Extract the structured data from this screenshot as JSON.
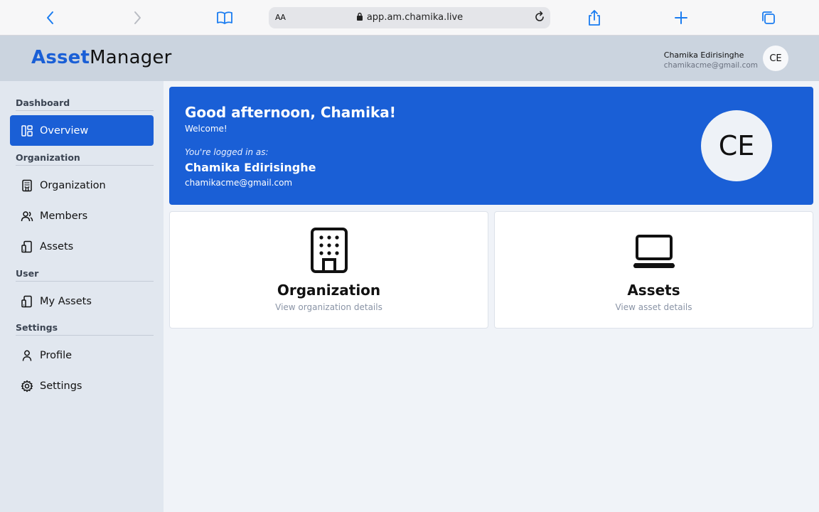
{
  "browser": {
    "aa_label": "AA",
    "url": "app.am.chamika.live",
    "icons": [
      "back-icon",
      "forward-icon",
      "bookmarks-icon",
      "lock-icon",
      "reload-icon",
      "share-icon",
      "new-tab-icon",
      "tabs-icon"
    ]
  },
  "header": {
    "logo_part1": "Asset",
    "logo_part2": "Manager",
    "user_name": "Chamika Edirisinghe",
    "user_email": "chamikacme@gmail.com",
    "avatar_initials": "CE"
  },
  "sidebar": {
    "sections": [
      {
        "title": "Dashboard",
        "items": [
          {
            "label": "Overview",
            "icon": "layout-icon",
            "active": true
          }
        ]
      },
      {
        "title": "Organization",
        "items": [
          {
            "label": "Organization",
            "icon": "building-icon"
          },
          {
            "label": "Members",
            "icon": "users-icon"
          },
          {
            "label": "Assets",
            "icon": "devices-icon"
          }
        ]
      },
      {
        "title": "User",
        "items": [
          {
            "label": "My Assets",
            "icon": "devices-icon"
          }
        ]
      },
      {
        "title": "Settings",
        "items": [
          {
            "label": "Profile",
            "icon": "user-icon"
          },
          {
            "label": "Settings",
            "icon": "gear-icon"
          }
        ]
      }
    ]
  },
  "welcome": {
    "greeting": "Good afternoon, Chamika!",
    "welcome_text": "Welcome!",
    "logged_in_as": "You're logged in as:",
    "name": "Chamika Edirisinghe",
    "email": "chamikacme@gmail.com",
    "avatar_initials": "CE"
  },
  "cards": [
    {
      "title": "Organization",
      "subtitle": "View organization details",
      "icon": "building-icon"
    },
    {
      "title": "Assets",
      "subtitle": "View asset details",
      "icon": "laptop-icon"
    }
  ],
  "colors": {
    "accent": "#1a5fd6",
    "header_bg": "#cbd4df",
    "sidebar_bg": "#e1e7ef",
    "page_bg": "#f0f3f8",
    "browser_icon": "#1a7cf0"
  }
}
